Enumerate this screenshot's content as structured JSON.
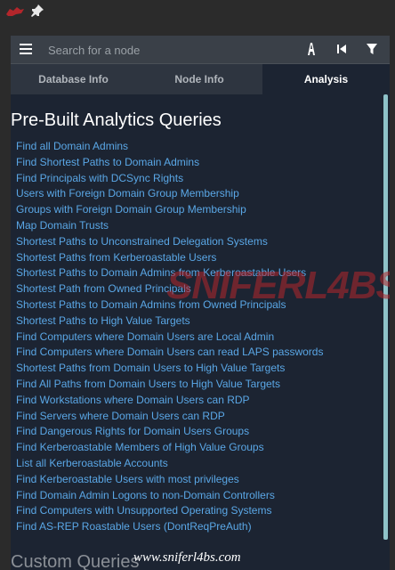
{
  "search": {
    "placeholder": "Search for a node"
  },
  "tabs": [
    {
      "label": "Database Info"
    },
    {
      "label": "Node Info"
    },
    {
      "label": "Analysis"
    }
  ],
  "analysis": {
    "heading": "Pre-Built Analytics Queries",
    "queries": [
      "Find all Domain Admins",
      "Find Shortest Paths to Domain Admins",
      "Find Principals with DCSync Rights",
      "Users with Foreign Domain Group Membership",
      "Groups with Foreign Domain Group Membership",
      "Map Domain Trusts",
      "Shortest Paths to Unconstrained Delegation Systems",
      "Shortest Paths from Kerberoastable Users",
      "Shortest Paths to Domain Admins from Kerberoastable Users",
      "Shortest Path from Owned Principals",
      "Shortest Paths to Domain Admins from Owned Principals",
      "Shortest Paths to High Value Targets",
      "Find Computers where Domain Users are Local Admin",
      "Find Computers where Domain Users can read LAPS passwords",
      "Shortest Paths from Domain Users to High Value Targets",
      "Find All Paths from Domain Users to High Value Targets",
      "Find Workstations where Domain Users can RDP",
      "Find Servers where Domain Users can RDP",
      "Find Dangerous Rights for Domain Users Groups",
      "Find Kerberoastable Members of High Value Groups",
      "List all Kerberoastable Accounts",
      "Find Kerberoastable Users with most privileges",
      "Find Domain Admin Logons to non-Domain Controllers",
      "Find Computers with Unsupported Operating Systems",
      "Find AS-REP Roastable Users (DontReqPreAuth)"
    ],
    "custom_heading": "Custom Queries"
  },
  "watermark": {
    "text": "SNIFERL4BS"
  },
  "footer": {
    "url": "www.sniferl4bs.com"
  },
  "icons": {
    "app_logo": "bloodhound-logo-icon",
    "pin": "pin-icon",
    "menu": "menu-icon",
    "pathfinding": "pathfinding-icon",
    "back": "back-icon",
    "filter": "filter-icon"
  },
  "colors": {
    "panel_bg": "#1c2432",
    "link": "#5aa7e6",
    "accent_scroll": "#8ec2c9"
  }
}
